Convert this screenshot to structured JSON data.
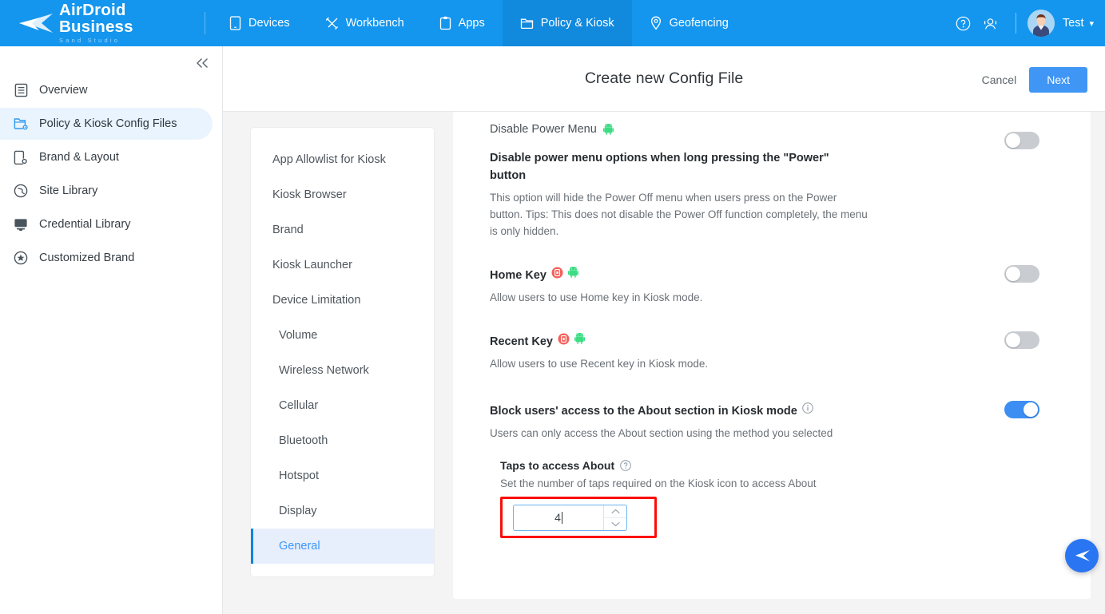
{
  "header": {
    "brand_name": "AirDroid Business",
    "brand_sub": "Sand Studio",
    "nav": [
      {
        "label": "Devices",
        "icon": "device-icon",
        "active": false
      },
      {
        "label": "Workbench",
        "icon": "tools-icon",
        "active": false
      },
      {
        "label": "Apps",
        "icon": "clipboard-icon",
        "active": false
      },
      {
        "label": "Policy & Kiosk",
        "icon": "folder-icon",
        "active": true
      },
      {
        "label": "Geofencing",
        "icon": "location-pin-icon",
        "active": false
      }
    ],
    "help_icon": "help-circle-icon",
    "support_icon": "headset-icon",
    "user_name": "Test",
    "caret_icon": "chevron-down-icon"
  },
  "sidebar": {
    "collapse_icon": "double-chevron-left-icon",
    "items": [
      {
        "label": "Overview",
        "icon": "document-icon",
        "active": false
      },
      {
        "label": "Policy & Kiosk Config Files",
        "icon": "folder-gear-icon",
        "active": true
      },
      {
        "label": "Brand & Layout",
        "icon": "phone-gear-icon",
        "active": false
      },
      {
        "label": "Site Library",
        "icon": "globe-icon",
        "active": false
      },
      {
        "label": "Credential Library",
        "icon": "certificate-icon",
        "active": false
      },
      {
        "label": "Customized Brand",
        "icon": "star-circle-icon",
        "active": false
      }
    ]
  },
  "page": {
    "title": "Create new Config File",
    "cancel_label": "Cancel",
    "next_label": "Next"
  },
  "subnav": {
    "items": [
      {
        "label": "App Allowlist for Kiosk",
        "sub": false,
        "active": false
      },
      {
        "label": "Kiosk Browser",
        "sub": false,
        "active": false
      },
      {
        "label": "Brand",
        "sub": false,
        "active": false
      },
      {
        "label": "Kiosk Launcher",
        "sub": false,
        "active": false
      },
      {
        "label": "Device Limitation",
        "sub": false,
        "active": false
      },
      {
        "label": "Volume",
        "sub": true,
        "active": false
      },
      {
        "label": "Wireless Network",
        "sub": true,
        "active": false
      },
      {
        "label": "Cellular",
        "sub": true,
        "active": false
      },
      {
        "label": "Bluetooth",
        "sub": true,
        "active": false
      },
      {
        "label": "Hotspot",
        "sub": true,
        "active": false
      },
      {
        "label": "Display",
        "sub": true,
        "active": false
      },
      {
        "label": "General",
        "sub": true,
        "active": true
      }
    ]
  },
  "main": {
    "group_label": "Disable Power Menu",
    "group_android_icon": "android-icon",
    "rows": [
      {
        "title": "Disable power menu options when long pressing the \"Power\" button",
        "desc": "This option will hide the Power Off menu when users press on the Power button. Tips: This does not disable the Power Off function completely, the menu is only hidden.",
        "toggle_on": false,
        "badges": []
      },
      {
        "title": "Home Key",
        "desc": "Allow users to use Home key in Kiosk mode.",
        "toggle_on": false,
        "badges": [
          "device-owner-icon",
          "android-icon"
        ]
      },
      {
        "title": "Recent Key",
        "desc": "Allow users to use Recent key in Kiosk mode.",
        "toggle_on": false,
        "badges": [
          "device-owner-icon",
          "android-icon"
        ]
      },
      {
        "title": "Block users' access to the About section in Kiosk mode",
        "desc": "Users can only access the About section using the method you selected",
        "toggle_on": true,
        "badges": [
          "info-circle-icon"
        ]
      }
    ],
    "sub_setting": {
      "title": "Taps to access About",
      "help_icon": "question-circle-icon",
      "desc": "Set the number of taps required on the Kiosk icon to access About",
      "input_value": "4",
      "stepper_up_icon": "chevron-up-icon",
      "stepper_down_icon": "chevron-down-icon",
      "highlight_color": "#fd0d06"
    }
  },
  "fab": {
    "icon": "send-arrow-icon"
  },
  "colors": {
    "brand_blue": "#1496ee",
    "accent": "#4096f5",
    "toggle_on": "#3c8ef3",
    "toggle_off": "#c9cdd1",
    "android_green": "#3ddc84",
    "badge_red": "#f4615b"
  }
}
